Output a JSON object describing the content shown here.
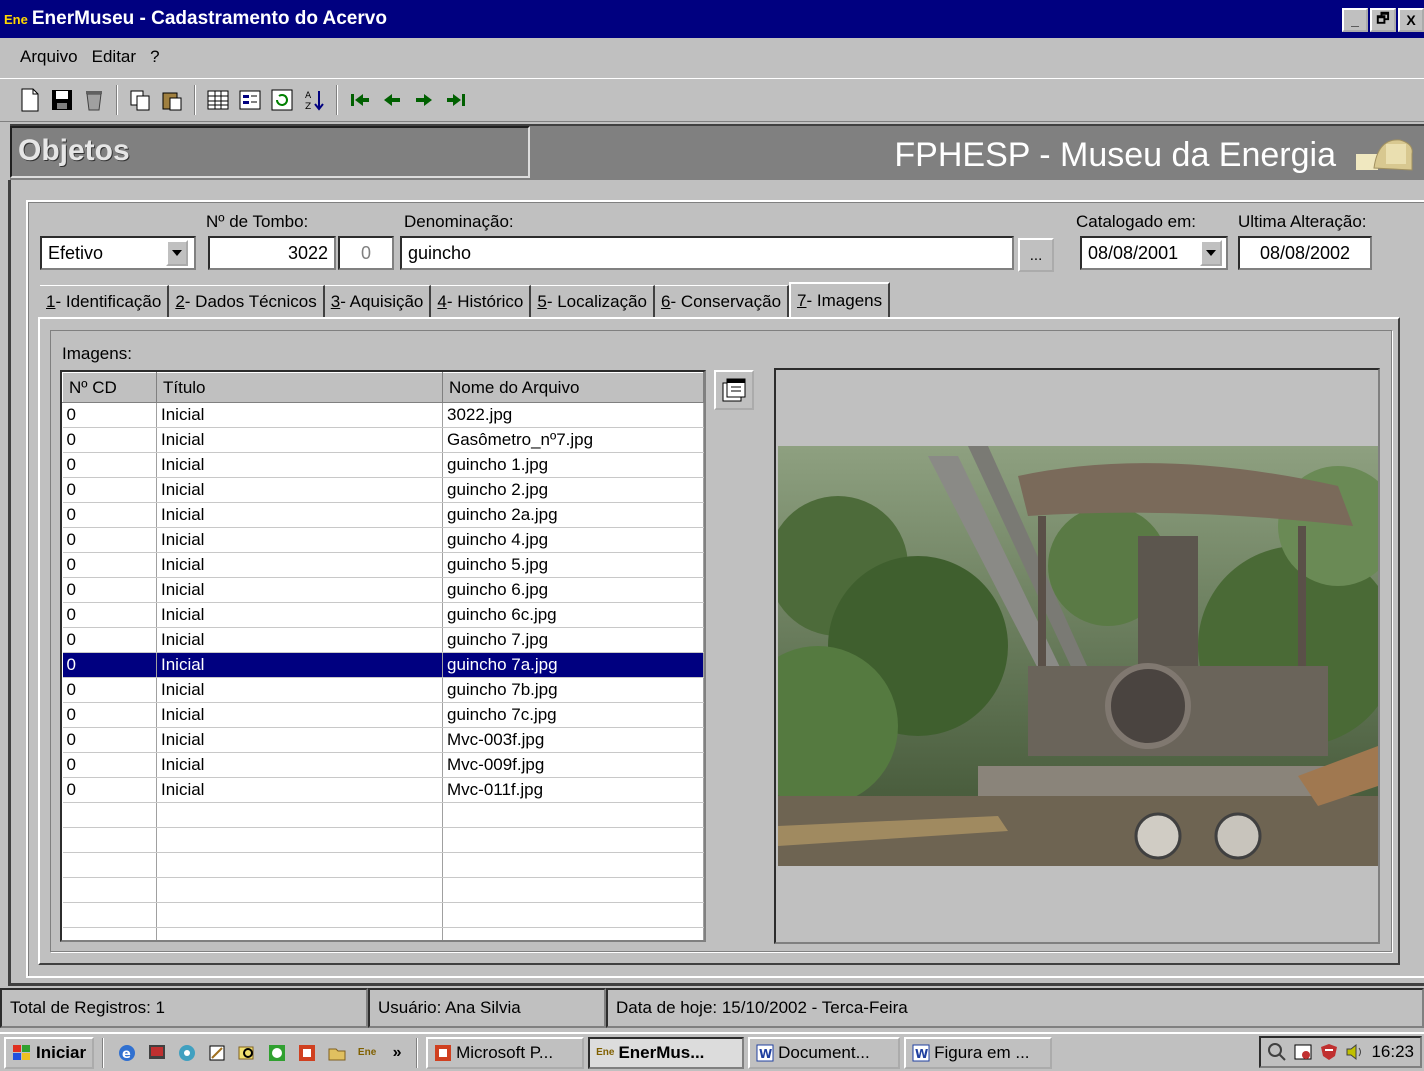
{
  "window": {
    "app_icon": "Ene",
    "title": "EnerMuseu - Cadastramento do Acervo",
    "controls": [
      "_",
      "🗗",
      "X"
    ]
  },
  "menu": [
    {
      "label": "Arquivo"
    },
    {
      "label": "Editar"
    },
    {
      "label": "?"
    }
  ],
  "header": {
    "section": "Objetos",
    "org": "FPHESP - Museu da Energia"
  },
  "form": {
    "status_value": "Efetivo",
    "tombo_label": "Nº de Tombo:",
    "tombo_value": "3022",
    "tombo_sub": "0",
    "denominacao_label": "Denominação:",
    "denominacao_value": "guincho",
    "more_btn": "...",
    "catalogado_label": "Catalogado em:",
    "catalogado_value": "08/08/2001",
    "alteracao_label": "Ultima Alteração:",
    "alteracao_value": "08/08/2002"
  },
  "tabs": [
    {
      "key": "1",
      "label": " - Identificação"
    },
    {
      "key": "2",
      "label": " - Dados Técnicos"
    },
    {
      "key": "3",
      "label": " - Aquisição"
    },
    {
      "key": "4",
      "label": " - Histórico"
    },
    {
      "key": "5",
      "label": " - Localização"
    },
    {
      "key": "6",
      "label": " - Conservação"
    },
    {
      "key": "7",
      "label": " - Imagens",
      "active": true
    }
  ],
  "images_section": {
    "label": "Imagens:",
    "columns": [
      "Nº CD",
      "Título",
      "Nome do Arquivo"
    ],
    "rows": [
      [
        "0",
        "Inicial",
        "3022.jpg"
      ],
      [
        "0",
        "Inicial",
        "Gasômetro_nº7.jpg"
      ],
      [
        "0",
        "Inicial",
        "guincho 1.jpg"
      ],
      [
        "0",
        "Inicial",
        "guincho 2.jpg"
      ],
      [
        "0",
        "Inicial",
        "guincho 2a.jpg"
      ],
      [
        "0",
        "Inicial",
        "guincho 4.jpg"
      ],
      [
        "0",
        "Inicial",
        "guincho 5.jpg"
      ],
      [
        "0",
        "Inicial",
        "guincho 6.jpg"
      ],
      [
        "0",
        "Inicial",
        "guincho 6c.jpg"
      ],
      [
        "0",
        "Inicial",
        "guincho 7.jpg"
      ],
      [
        "0",
        "Inicial",
        "guincho 7a.jpg"
      ],
      [
        "0",
        "Inicial",
        "guincho 7b.jpg"
      ],
      [
        "0",
        "Inicial",
        "guincho 7c.jpg"
      ],
      [
        "0",
        "Inicial",
        "Mvc-003f.jpg"
      ],
      [
        "0",
        "Inicial",
        "Mvc-009f.jpg"
      ],
      [
        "0",
        "Inicial",
        "Mvc-011f.jpg"
      ]
    ],
    "selected_row": 10,
    "empty_rows": 6
  },
  "status": {
    "total": "Total de Registros: 1",
    "user": "Usuário: Ana Silvia",
    "date": "Data de hoje: 15/10/2002 - Terca-Feira"
  },
  "taskbar": {
    "start": "Iniciar",
    "more": "»",
    "tasks": [
      {
        "label": "Microsoft P..."
      },
      {
        "label": "EnerMus...",
        "active": true
      },
      {
        "label": "Document..."
      },
      {
        "label": "Figura em ..."
      }
    ],
    "clock": "16:23"
  },
  "icons": {
    "toolbar": [
      "new-icon",
      "save-icon",
      "delete-icon",
      "copy-icon",
      "paste-icon",
      "grid-view-icon",
      "form-view-icon",
      "refresh-icon",
      "sort-icon",
      "first-record-icon",
      "prev-record-icon",
      "next-record-icon",
      "last-record-icon"
    ]
  },
  "colors": {
    "titlebar": "#000080",
    "selection": "#000080",
    "face": "#c0c0c0"
  }
}
